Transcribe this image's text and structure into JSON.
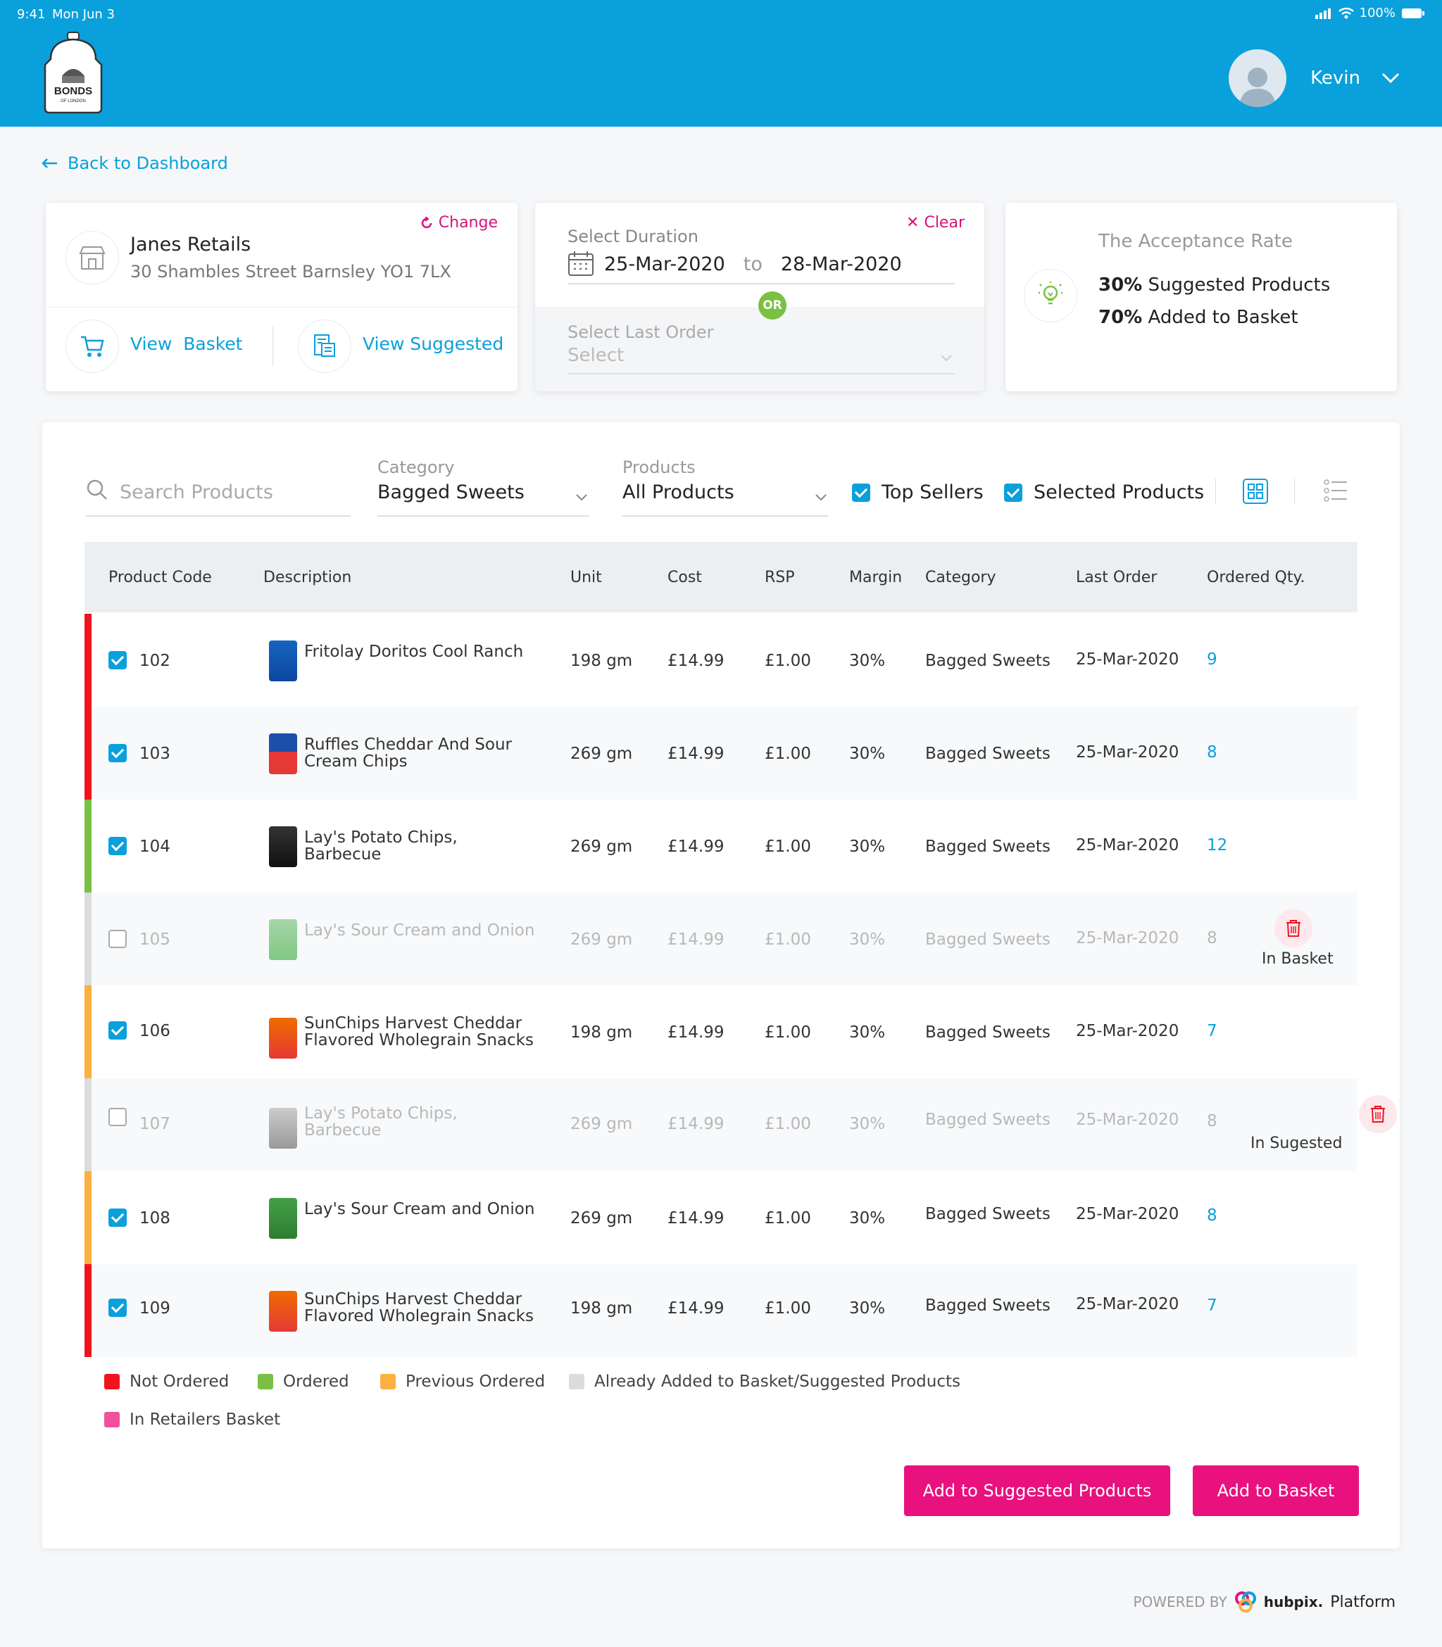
{
  "status_bar": {
    "time": "9:41",
    "date": "Mon Jun 3",
    "battery": "100%"
  },
  "brand": {
    "logo_text": "BONDS",
    "logo_sub": "OF LONDON"
  },
  "user": {
    "name": "Kevin"
  },
  "nav": {
    "back_label": "Back to Dashboard"
  },
  "retailer": {
    "name": "Janes Retails",
    "address": "30 Shambles Street Barnsley YO1 7LX",
    "change_label": "Change",
    "view_basket_label": "View  Basket",
    "view_suggested_label": "View Suggested"
  },
  "duration": {
    "label": "Select Duration",
    "clear_label": "Clear",
    "from": "25-Mar-2020",
    "to_label": "to",
    "to": "28-Mar-2020",
    "or_label": "OR",
    "last_order_label": "Select Last Order",
    "last_order_value": "Select"
  },
  "acceptance": {
    "title": "The Acceptance Rate",
    "suggested_pct": "30%",
    "suggested_label": "Suggested Products",
    "added_pct": "70%",
    "added_label": "Added to Basket"
  },
  "filters": {
    "search_placeholder": "Search Products",
    "category_label": "Category",
    "category_value": "Bagged Sweets",
    "products_label": "Products",
    "products_value": "All Products",
    "top_sellers_label": "Top Sellers",
    "selected_products_label": "Selected Products"
  },
  "table": {
    "headers": [
      "Product Code",
      "Description",
      "Unit",
      "Cost",
      "RSP",
      "Margin",
      "Category",
      "Last Order",
      "Ordered Qty."
    ],
    "rows": [
      {
        "code": "102",
        "desc": "Fritolay Doritos Cool Ranch",
        "unit": "198 gm",
        "cost": "£14.99",
        "rsp": "£1.00",
        "margin": "30%",
        "category": "Bagged Sweets",
        "last_order": "25-Mar-2020",
        "qty": "9",
        "action": ""
      },
      {
        "code": "103",
        "desc": "Ruffles Cheddar And Sour Cream Chips",
        "unit": "269 gm",
        "cost": "£14.99",
        "rsp": "£1.00",
        "margin": "30%",
        "category": "Bagged Sweets",
        "last_order": "25-Mar-2020",
        "qty": "8",
        "action": ""
      },
      {
        "code": "104",
        "desc": "Lay's Potato Chips, Barbecue",
        "unit": "269 gm",
        "cost": "£14.99",
        "rsp": "£1.00",
        "margin": "30%",
        "category": "Bagged Sweets",
        "last_order": "25-Mar-2020",
        "qty": "12",
        "action": ""
      },
      {
        "code": "105",
        "desc": "Lay's Sour Cream and Onion",
        "unit": "269 gm",
        "cost": "£14.99",
        "rsp": "£1.00",
        "margin": "30%",
        "category": "Bagged Sweets",
        "last_order": "25-Mar-2020",
        "qty": "8",
        "action": "In Basket"
      },
      {
        "code": "106",
        "desc": "SunChips Harvest Cheddar Flavored Wholegrain Snacks",
        "unit": "198 gm",
        "cost": "£14.99",
        "rsp": "£1.00",
        "margin": "30%",
        "category": "Bagged Sweets",
        "last_order": "25-Mar-2020",
        "qty": "7",
        "action": ""
      },
      {
        "code": "107",
        "desc": "Lay's Potato Chips, Barbecue",
        "unit": "269 gm",
        "cost": "£14.99",
        "rsp": "£1.00",
        "margin": "30%",
        "category": "Bagged Sweets",
        "last_order": "25-Mar-2020",
        "qty": "8",
        "action": "In Sugested"
      },
      {
        "code": "108",
        "desc": "Lay's Sour Cream and Onion",
        "unit": "269 gm",
        "cost": "£14.99",
        "rsp": "£1.00",
        "margin": "30%",
        "category": "Bagged Sweets",
        "last_order": "25-Mar-2020",
        "qty": "8",
        "action": ""
      },
      {
        "code": "109",
        "desc": "SunChips Harvest Cheddar Flavored Wholegrain Snacks",
        "unit": "198 gm",
        "cost": "£14.99",
        "rsp": "£1.00",
        "margin": "30%",
        "category": "Bagged Sweets",
        "last_order": "25-Mar-2020",
        "qty": "7",
        "action": ""
      }
    ]
  },
  "legend": [
    {
      "label": "Not Ordered",
      "color": "#f0141e"
    },
    {
      "label": "Ordered",
      "color": "#7ac143"
    },
    {
      "label": "Previous Ordered",
      "color": "#fbb040"
    },
    {
      "label": "Already Added to Basket/Suggested Products",
      "color": "#dcdcdc"
    },
    {
      "label": "In Retailers Basket",
      "color": "#f0509c"
    }
  ],
  "buttons": {
    "add_suggested": "Add to Suggested Products",
    "add_basket": "Add to Basket"
  },
  "footer": {
    "powered_by": "POWERED BY",
    "brand": "hubpix.",
    "platform": "Platform"
  },
  "colors": {
    "header": "#0aa0dc",
    "accent": "#0aa0dc",
    "button": "#e8117e",
    "link_pink": "#d8127a"
  }
}
